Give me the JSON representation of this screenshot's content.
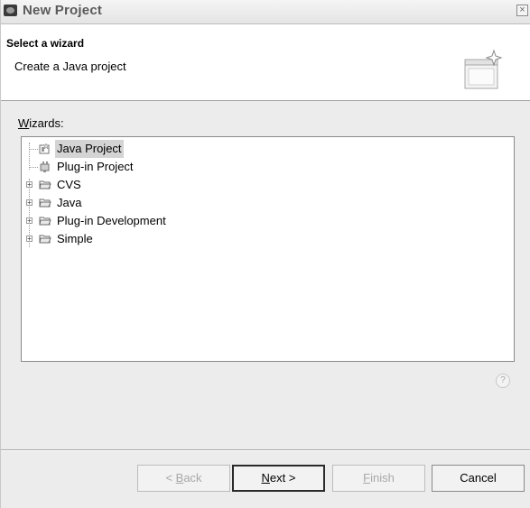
{
  "window": {
    "title": "New Project",
    "close_glyph": "×"
  },
  "banner": {
    "title": "Select a wizard",
    "description": "Create a Java project",
    "image": "wizard-banner-icon"
  },
  "wizards": {
    "label_mnemonic": "W",
    "label_rest": "izards:",
    "items": [
      {
        "label": "Java Project",
        "icon": "java-project-icon",
        "expandable": false,
        "selected": true
      },
      {
        "label": "Plug-in Project",
        "icon": "plugin-project-icon",
        "expandable": false,
        "selected": false
      },
      {
        "label": "CVS",
        "icon": "folder-icon",
        "expandable": true,
        "selected": false
      },
      {
        "label": "Java",
        "icon": "folder-icon",
        "expandable": true,
        "selected": false
      },
      {
        "label": "Plug-in Development",
        "icon": "folder-icon",
        "expandable": true,
        "selected": false
      },
      {
        "label": "Simple",
        "icon": "folder-icon",
        "expandable": true,
        "selected": false
      }
    ]
  },
  "help": {
    "glyph": "?"
  },
  "buttons": {
    "back": {
      "prefix": "< ",
      "mnemonic": "B",
      "rest": "ack",
      "enabled": false
    },
    "next": {
      "mnemonic": "N",
      "rest": "ext >",
      "enabled": true,
      "default": true
    },
    "finish": {
      "mnemonic": "F",
      "rest": "inish",
      "enabled": false
    },
    "cancel": {
      "label": "Cancel",
      "enabled": true
    }
  }
}
